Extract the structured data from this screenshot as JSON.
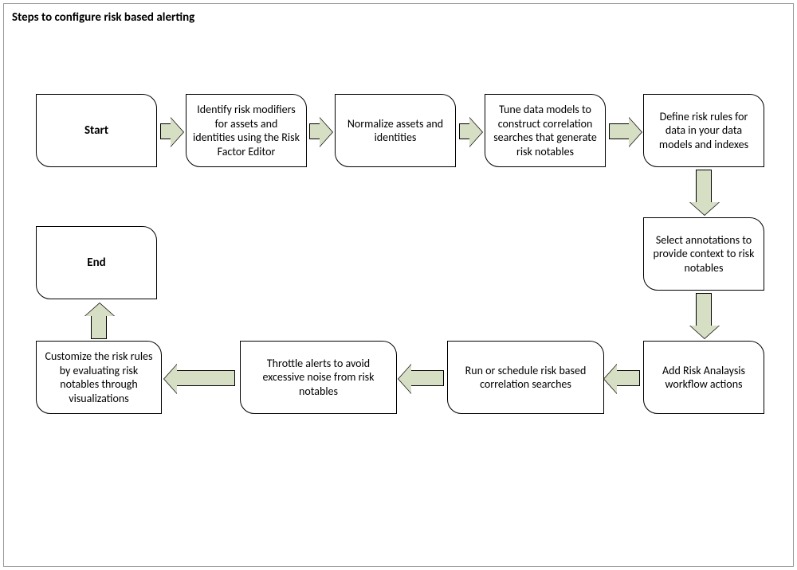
{
  "title": "Steps to configure risk based alerting",
  "steps": {
    "start": "Start",
    "s1": "Identify risk modifiers for assets and identities using the Risk Factor Editor",
    "s2": "Normalize assets and identities",
    "s3": "Tune data models to construct correlation searches that generate risk notables",
    "s4": "Define risk rules for data in your data models and indexes",
    "s5": "Select annotations to provide context to risk notables",
    "s6": "Add Risk Analaysis workflow actions",
    "s7": "Run or schedule risk based correlation searches",
    "s8": "Throttle alerts to avoid excessive noise from risk notables",
    "s9": "Customize the risk rules by evaluating risk notables through visualizations",
    "end": "End"
  }
}
